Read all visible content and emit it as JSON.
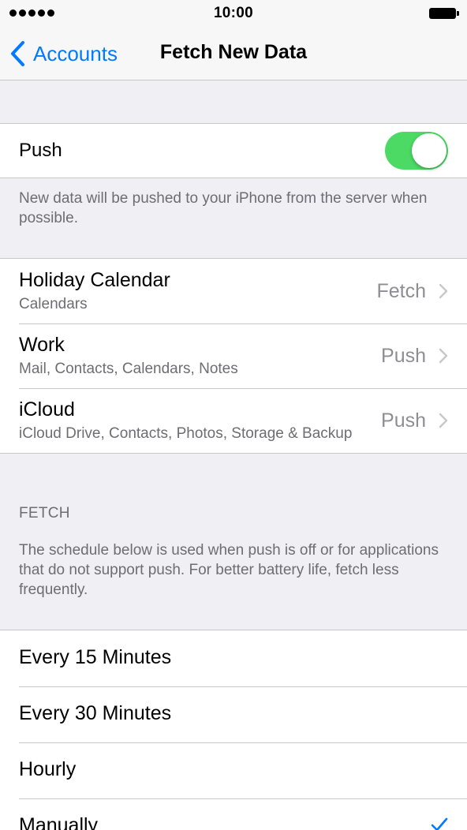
{
  "status_bar": {
    "time": "10:00",
    "signal_icon": "signal-dots-icon",
    "battery_icon": "battery-full-icon"
  },
  "nav": {
    "back_label": "Accounts",
    "back_icon": "chevron-left-icon",
    "title": "Fetch New Data"
  },
  "push": {
    "label": "Push",
    "enabled": true,
    "toggle_color": "#4cd964",
    "footer": "New data will be pushed to your iPhone from the server when possible."
  },
  "accounts": [
    {
      "title": "Holiday Calendar",
      "subtitle": "Calendars",
      "value": "Fetch"
    },
    {
      "title": "Work",
      "subtitle": "Mail, Contacts, Calendars, Notes",
      "value": "Push"
    },
    {
      "title": "iCloud",
      "subtitle": "iCloud Drive, Contacts, Photos, Storage & Backup",
      "value": "Push"
    }
  ],
  "fetch": {
    "header": "FETCH",
    "description": "The schedule below is used when push is off or for applications that do not support push. For better battery life, fetch less frequently.",
    "options": [
      {
        "label": "Every 15 Minutes",
        "selected": false
      },
      {
        "label": "Every 30 Minutes",
        "selected": false
      },
      {
        "label": "Hourly",
        "selected": false
      },
      {
        "label": "Manually",
        "selected": true
      }
    ]
  },
  "colors": {
    "accent": "#007aff",
    "background": "#efeff4",
    "secondary_text": "#6d6d72",
    "separator": "#c8c7cc"
  }
}
